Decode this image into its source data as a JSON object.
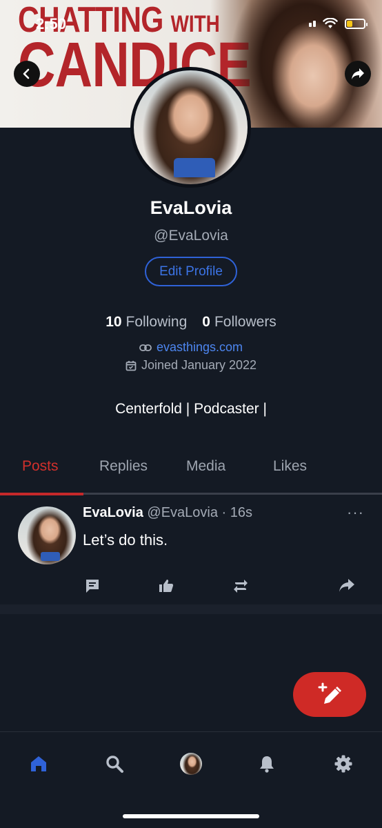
{
  "status_bar": {
    "time": "2:50",
    "battery_color": "#f5c518",
    "battery_level": 0.35
  },
  "banner": {
    "line1_main": "CHATTING",
    "line1_small": "WITH",
    "line2": "CANDICE",
    "title_color": "#b3252a"
  },
  "icons": {
    "back": "chevron-left-icon",
    "share": "share-arrow-icon",
    "link": "link-icon",
    "calendar": "calendar-icon",
    "comment": "comment-icon",
    "like": "thumbs-up-icon",
    "repost": "repost-icon",
    "forward": "forward-icon",
    "compose": "compose-icon",
    "home": "home-icon",
    "search": "search-icon",
    "bell": "bell-icon",
    "gear": "gear-icon"
  },
  "profile": {
    "name": "EvaLovia",
    "handle": "@EvaLovia",
    "edit_label": "Edit Profile",
    "following_count": "10",
    "following_label": "Following",
    "followers_count": "0",
    "followers_label": "Followers",
    "website": "evasthings.com",
    "joined": "Joined January 2022",
    "bio": "Centerfold | Podcaster |"
  },
  "tabs": [
    {
      "label": "Posts",
      "active": true
    },
    {
      "label": "Replies",
      "active": false
    },
    {
      "label": "Media",
      "active": false
    },
    {
      "label": "Likes",
      "active": false
    }
  ],
  "post": {
    "author": "EvaLovia",
    "handle": "@EvaLovia",
    "separator": "·",
    "time": "16s",
    "text": "Let’s do this.",
    "more": "···"
  },
  "colors": {
    "accent_red": "#cf2a26",
    "link_blue": "#4d86f0",
    "background": "#141a24",
    "home_active": "#2f62d8"
  }
}
